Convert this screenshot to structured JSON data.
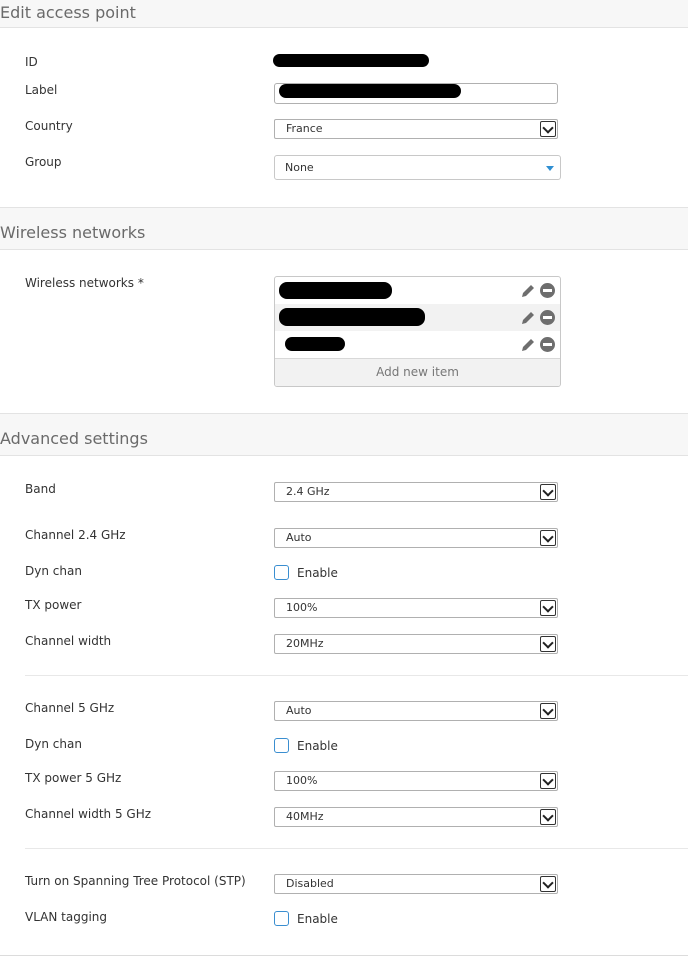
{
  "sections": {
    "edit": "Edit access point",
    "wireless": "Wireless networks",
    "advanced": "Advanced settings"
  },
  "edit": {
    "id_label": "ID",
    "label_label": "Label",
    "country_label": "Country",
    "country_value": "France",
    "group_label": "Group",
    "group_value": "None"
  },
  "wireless": {
    "networks_label": "Wireless networks *",
    "add_item": "Add new item"
  },
  "advanced": {
    "band_label": "Band",
    "band_value": "2.4 GHz",
    "channel24_label": "Channel 2.4 GHz",
    "channel24_value": "Auto",
    "dynchan1_label": "Dyn chan",
    "dynchan1_enable": "Enable",
    "txpower_label": "TX power",
    "txpower_value": "100%",
    "chwidth_label": "Channel width",
    "chwidth_value": "20MHz",
    "channel5_label": "Channel 5 GHz",
    "channel5_value": "Auto",
    "dynchan2_label": "Dyn chan",
    "dynchan2_enable": "Enable",
    "txpower5_label": "TX power 5 GHz",
    "txpower5_value": "100%",
    "chwidth5_label": "Channel width 5 GHz",
    "chwidth5_value": "40MHz",
    "stp_label": "Turn on Spanning Tree Protocol (STP)",
    "stp_value": "Disabled",
    "vlan_label": "VLAN tagging",
    "vlan_enable": "Enable"
  },
  "colors": {
    "accent": "#3a8ed0",
    "header_bg": "#f7f7f7",
    "redaction": "#000000"
  },
  "icons": {
    "edit": "pencil-icon",
    "remove": "minus-circle-icon",
    "dropdown": "chevron-down-icon"
  }
}
